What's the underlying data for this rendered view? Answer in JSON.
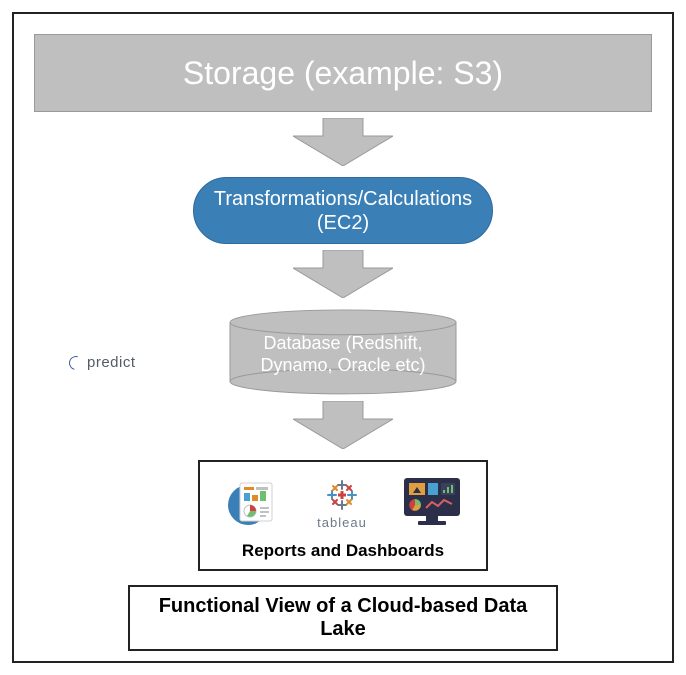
{
  "diagram": {
    "storage_label": "Storage (example: S3)",
    "transform_label": "Transformations/Calculations\n(EC2)",
    "database_label": "Database (Redshift,\nDynamo, Oracle etc)",
    "reports_label": "Reports and Dashboards",
    "tool_label": "tableau",
    "caption": "Functional View of a Cloud-based Data Lake"
  },
  "watermark": {
    "text": "predict"
  },
  "colors": {
    "gray": "#bfbfbf",
    "blue": "#3b7fb7",
    "border": "#000000"
  }
}
